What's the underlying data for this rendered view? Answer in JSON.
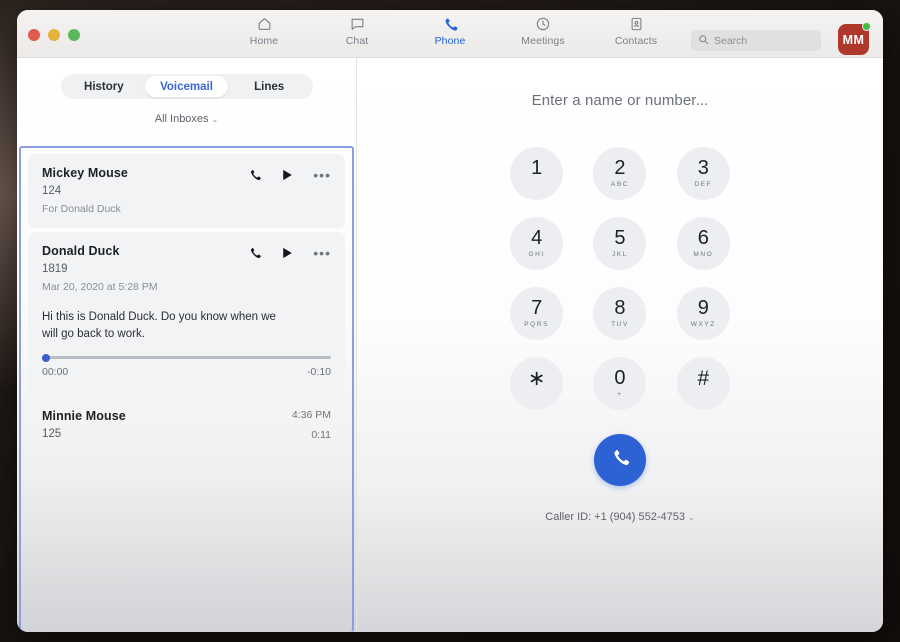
{
  "window": {
    "traffic_lights": [
      "close",
      "minimize",
      "maximize"
    ]
  },
  "nav": {
    "items": [
      {
        "label": "Home",
        "icon": "home-icon",
        "active": false
      },
      {
        "label": "Chat",
        "icon": "chat-bubble-icon",
        "active": false
      },
      {
        "label": "Phone",
        "icon": "phone-icon",
        "active": true
      },
      {
        "label": "Meetings",
        "icon": "clock-icon",
        "active": false
      },
      {
        "label": "Contacts",
        "icon": "contact-card-icon",
        "active": false
      }
    ]
  },
  "search": {
    "placeholder": "Search",
    "value": "",
    "icon": "search-icon"
  },
  "avatar": {
    "initials": "MM",
    "status": "available",
    "status_color": "#3ec13e",
    "bg_color": "#b0382b"
  },
  "sidebar": {
    "tabs": [
      {
        "label": "History",
        "active": false
      },
      {
        "label": "Voicemail",
        "active": true
      },
      {
        "label": "Lines",
        "active": false
      }
    ],
    "inbox_filter": {
      "label": "All Inboxes",
      "chevron": "⌄"
    },
    "voicemails": [
      {
        "name": "Mickey Mouse",
        "number": "124",
        "subtitle": "For Donald Duck",
        "actions": [
          "call-icon",
          "play-icon",
          "more-options-icon"
        ],
        "selected": true
      },
      {
        "name": "Donald Duck",
        "number": "1819",
        "subtitle": "Mar 20, 2020 at 5:28 PM",
        "actions": [
          "call-icon",
          "play-icon",
          "more-options-icon"
        ],
        "transcript": "Hi this is Donald Duck. Do you know when we will go back to work.",
        "player": {
          "elapsed": "00:00",
          "remaining": "-0:10",
          "progress_percent": 0
        },
        "expanded": true
      },
      {
        "name": "Minnie Mouse",
        "number": "125",
        "time": "4:36 PM",
        "duration": "0:11"
      }
    ]
  },
  "dialer": {
    "title": "Enter a name or number...",
    "keys": [
      {
        "digit": "1",
        "letters": ""
      },
      {
        "digit": "2",
        "letters": "ABC"
      },
      {
        "digit": "3",
        "letters": "DEF"
      },
      {
        "digit": "4",
        "letters": "GHI"
      },
      {
        "digit": "5",
        "letters": "JKL"
      },
      {
        "digit": "6",
        "letters": "MNO"
      },
      {
        "digit": "7",
        "letters": "PQRS"
      },
      {
        "digit": "8",
        "letters": "TUV"
      },
      {
        "digit": "9",
        "letters": "WXYZ"
      },
      {
        "digit": "∗",
        "letters": ""
      },
      {
        "digit": "0",
        "letters": "+"
      },
      {
        "digit": "#",
        "letters": ""
      }
    ],
    "call_button": {
      "icon": "phone-icon",
      "color": "#2d62d4"
    },
    "caller_id": {
      "label": "Caller ID: +1 (904) 552-4753",
      "chevron": "⌄"
    }
  },
  "colors": {
    "accent": "#2563d9",
    "selection_ring": "#8c9ede",
    "card_bg": "#f2f3f5"
  }
}
